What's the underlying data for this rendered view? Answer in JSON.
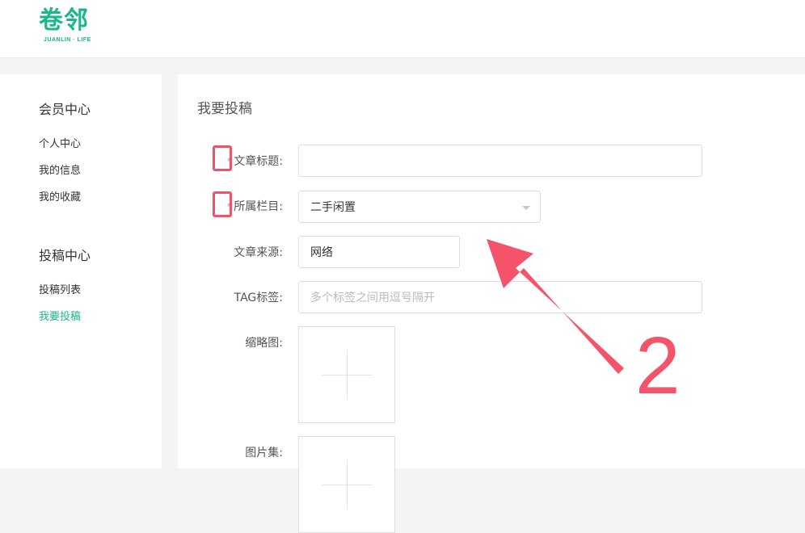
{
  "header": {
    "logo_cn": "卷邻",
    "logo_en": "JUANLIN · LIFE"
  },
  "sidebar": {
    "sections": [
      {
        "title": "会员中心",
        "items": [
          {
            "label": "个人中心"
          },
          {
            "label": "我的信息"
          },
          {
            "label": "我的收藏"
          }
        ]
      },
      {
        "title": "投稿中心",
        "items": [
          {
            "label": "投稿列表"
          },
          {
            "label": "我要投稿",
            "active": true
          }
        ]
      }
    ]
  },
  "form": {
    "title": "我要投稿",
    "required_mark": "*",
    "fields": {
      "article_title": {
        "label": "文章标题:",
        "value": ""
      },
      "category": {
        "label": "所属栏目:",
        "value": "二手闲置"
      },
      "source": {
        "label": "文章来源:",
        "value": "网络"
      },
      "tags": {
        "label": "TAG标签:",
        "placeholder": "多个标签之间用逗号隔开"
      },
      "thumbnail": {
        "label": "缩略图:"
      },
      "gallery": {
        "label": "图片集:"
      }
    }
  },
  "annotation": {
    "number": "2",
    "color": "#f4536a"
  },
  "colors": {
    "accent": "#19b78b",
    "required": "#e8424f",
    "highlight_box": "#f0526a"
  }
}
